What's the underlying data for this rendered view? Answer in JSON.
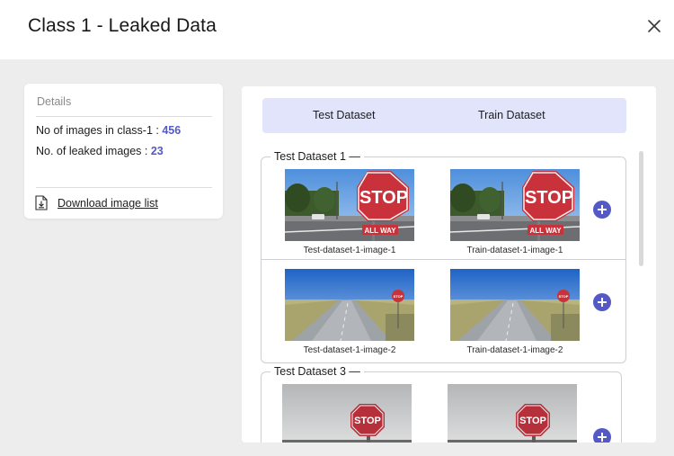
{
  "modal": {
    "title": "Class 1 - Leaked Data",
    "close_icon": "close-icon"
  },
  "details": {
    "title": "Details",
    "images_in_class_label": "No of images in class-1 : ",
    "images_in_class_value": "456",
    "leaked_images_label": "No. of leaked images : ",
    "leaked_images_value": "23",
    "download_label": "Download image list",
    "download_icon": "download-file-icon"
  },
  "tabs": [
    {
      "label": "Test Dataset"
    },
    {
      "label": "Train Dataset"
    }
  ],
  "groups": [
    {
      "title": "Test Dataset 1",
      "rows": [
        {
          "test_caption": "Test-dataset-1-image-1",
          "train_caption": "Train-dataset-1-image-1"
        },
        {
          "test_caption": "Test-dataset-1-image-2",
          "train_caption": "Train-dataset-1-image-2"
        }
      ]
    },
    {
      "title": "Test Dataset 3",
      "rows": [
        {
          "test_caption": "",
          "train_caption": ""
        }
      ]
    }
  ],
  "image_text": {
    "stop": "STOP",
    "all_way": "ALL WAY"
  },
  "colors": {
    "accent": "#5459c6",
    "tab_bg": "#e1e4fb",
    "page_bg": "#ededee"
  }
}
